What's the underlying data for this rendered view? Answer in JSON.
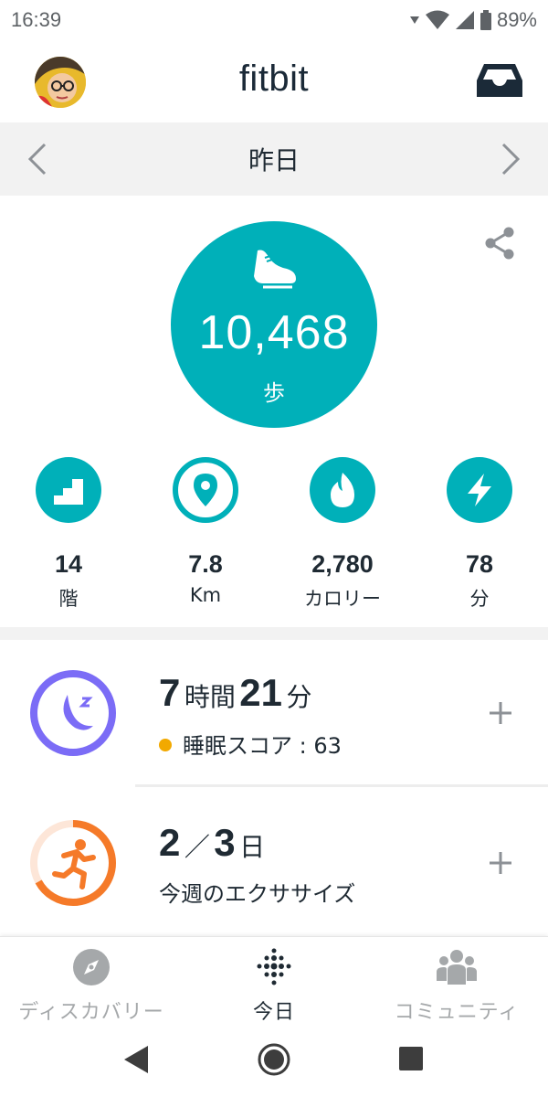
{
  "status": {
    "time": "16:39",
    "battery": "89%"
  },
  "header": {
    "brand": "fitbit"
  },
  "date_nav": {
    "label": "昨日"
  },
  "steps": {
    "value": "10,468",
    "unit": "歩"
  },
  "stats": [
    {
      "value": "14",
      "unit": "階",
      "icon": "stairs-icon"
    },
    {
      "value": "7.8",
      "unit": "Km",
      "icon": "location-pin-icon"
    },
    {
      "value": "2,780",
      "unit": "カロリー",
      "icon": "flame-icon"
    },
    {
      "value": "78",
      "unit": "分",
      "icon": "lightning-icon"
    }
  ],
  "sleep": {
    "hours": "7",
    "hours_unit": "時間",
    "minutes": "21",
    "minutes_unit": "分",
    "score_text": "睡眠スコア : 63",
    "score_color": "#f2a900"
  },
  "exercise": {
    "done": "2",
    "slash": "／",
    "goal": "3",
    "unit": "日",
    "label": "今週のエクササイズ",
    "progress": 0.67
  },
  "tabs": [
    {
      "label": "ディスカバリー",
      "icon": "compass-icon"
    },
    {
      "label": "今日",
      "icon": "fitbit-dots-icon"
    },
    {
      "label": "コミュニティ",
      "icon": "community-icon"
    }
  ],
  "colors": {
    "teal": "#00b0b9",
    "sleep_purple": "#7b6cf6",
    "exercise_orange": "#f57a29"
  }
}
